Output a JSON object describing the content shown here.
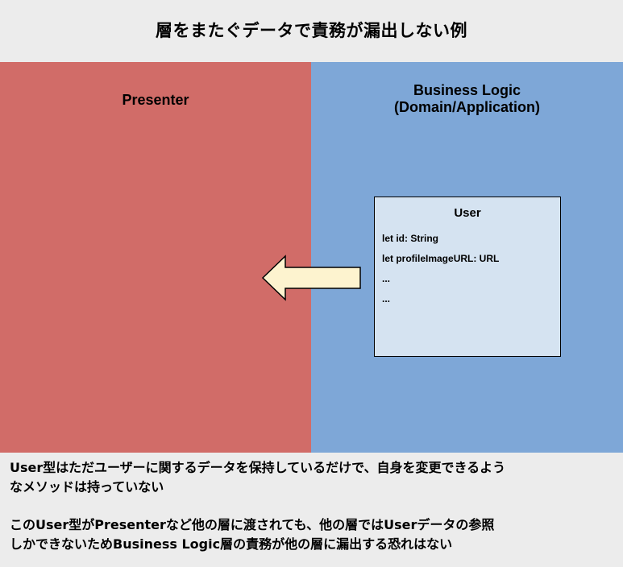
{
  "title": "層をまたぐデータで責務が漏出しない例",
  "presenter": {
    "title": "Presenter"
  },
  "business": {
    "title_line1": "Business Logic",
    "title_line2": "(Domain/Application)"
  },
  "user_box": {
    "title": "User",
    "fields": [
      "let id: String",
      "let profileImageURL: URL",
      "...",
      "..."
    ]
  },
  "colors": {
    "presenter": "#d16c68",
    "business": "#7ea7d7",
    "user_box": "#d5e3f1",
    "arrow_fill": "#fdf3cf",
    "background": "#ececec"
  },
  "description": {
    "paragraph1_line1": "User型はただユーザーに関するデータを保持しているだけで、自身を変更できるよう",
    "paragraph1_line2": "なメソッドは持っていない",
    "paragraph2_line1": "このUser型がPresenterなど他の層に渡されても、他の層ではUserデータの参照",
    "paragraph2_line2": "しかできないためBusiness Logic層の責務が他の層に漏出する恐れはない"
  }
}
